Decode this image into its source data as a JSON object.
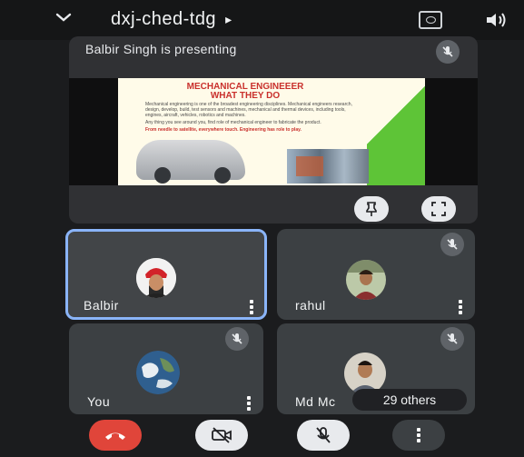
{
  "header": {
    "meeting_code": "dxj-ched-tdg",
    "arrow": "▸"
  },
  "presentation": {
    "label": "Balbir Singh is presenting",
    "slide": {
      "title_line1": "MECHANICAL ENGINEEER",
      "title_line2": "WHAT THEY DO",
      "bullets": [
        "Mechanical engineering is one of the broadest engineering disciplines. Mechanical engineers research, design, develop, build, test sensors and machines, mechanical and thermal devices, including tools, engines, aircraft, vehicles, robotics and machines.",
        "Any thing you see around you, find role of mechanical engineer to fabricate the product.",
        "From needle to satellite, everywhere touch. Engineering has role to play."
      ]
    }
  },
  "participants": [
    {
      "name": "Balbir",
      "active": true
    },
    {
      "name": "rahul",
      "active": false
    },
    {
      "name": "You",
      "active": false
    },
    {
      "name": "Md Mc",
      "active": false
    }
  ],
  "others_label": "29 others",
  "colors": {
    "end_call": "#e0453a",
    "active_outline": "#8ab4f8",
    "tile_bg": "#3c4043"
  }
}
